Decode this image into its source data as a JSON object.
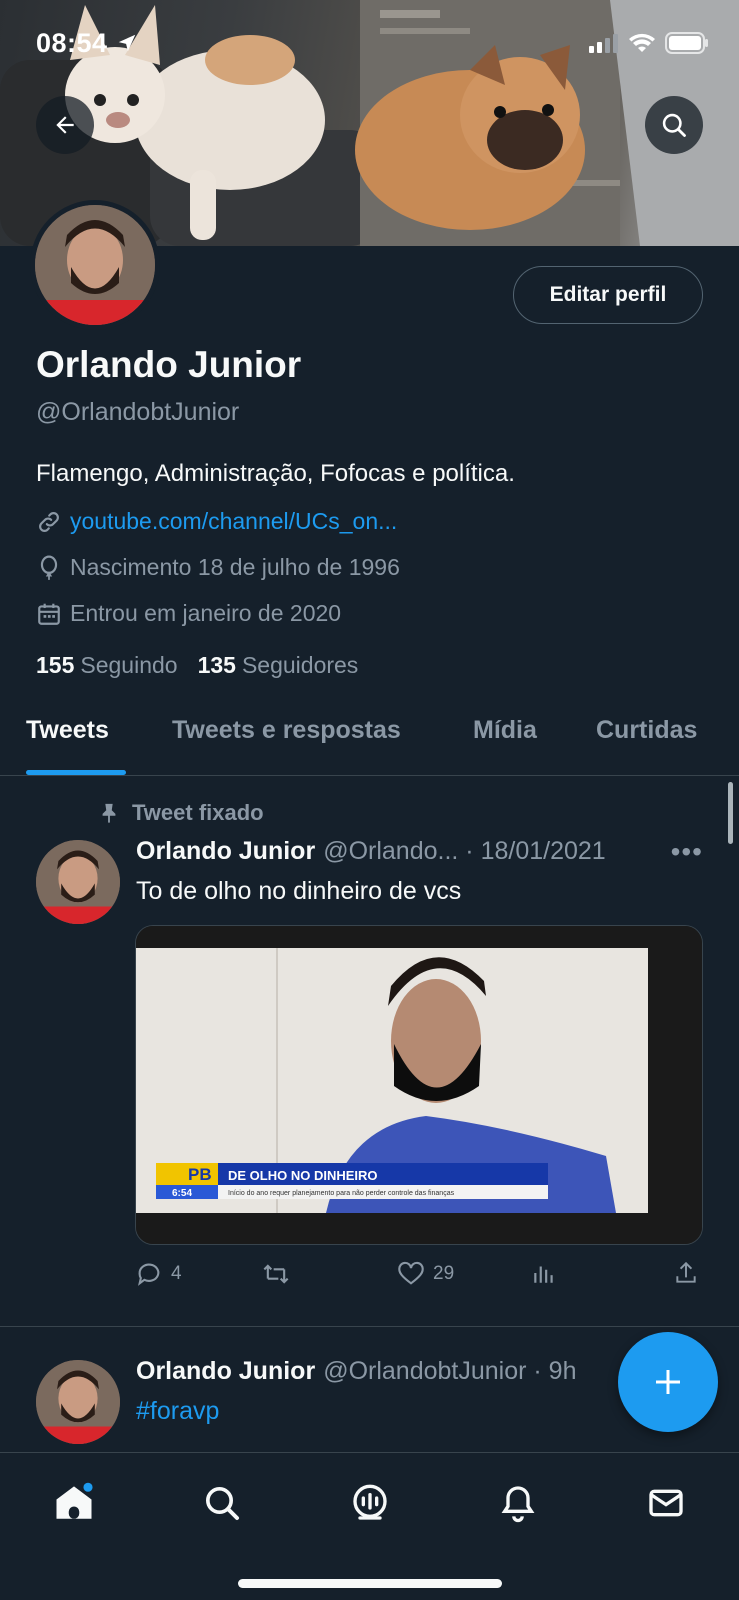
{
  "status": {
    "time": "08:54"
  },
  "profile": {
    "name": "Orlando Junior",
    "handle": "@OrlandobtJunior",
    "edit_label": "Editar perfil",
    "bio": "Flamengo, Administração, Fofocas e política.",
    "link": "youtube.com/channel/UCs_on...",
    "birth": "Nascimento 18 de julho de 1996",
    "joined": "Entrou em janeiro de 2020",
    "following_count": "155",
    "following_label": "Seguindo",
    "followers_count": "135",
    "followers_label": "Seguidores"
  },
  "tabs": [
    {
      "label": "Tweets",
      "active": true
    },
    {
      "label": "Tweets e respostas"
    },
    {
      "label": "Mídia"
    },
    {
      "label": "Curtidas"
    }
  ],
  "pinned_label": "Tweet fixado",
  "tweets": [
    {
      "name": "Orlando Junior",
      "handle": "@Orlando...",
      "date": "· 18/01/2021",
      "text": "To de olho no dinheiro de vcs",
      "media": {
        "channel": "PB",
        "time": "6:54",
        "headline": "DE OLHO NO DINHEIRO",
        "subline": "Início do ano requer planejamento para não perder controle das finanças"
      },
      "replies": "4",
      "likes": "29"
    },
    {
      "name": "Orlando Junior",
      "handle": "@OrlandobtJunior",
      "date": "· 9h",
      "text": "#foravp"
    }
  ],
  "colors": {
    "accent": "#1d9bf0",
    "background": "#15202b",
    "muted": "#8b98a5"
  },
  "icons": [
    "back-arrow-icon",
    "search-icon",
    "link-icon",
    "balloon-icon",
    "calendar-icon",
    "pin-icon",
    "more-icon",
    "reply-icon",
    "retweet-icon",
    "like-icon",
    "analytics-icon",
    "share-icon",
    "compose-icon",
    "home-icon",
    "spaces-icon",
    "bell-icon",
    "mail-icon"
  ]
}
